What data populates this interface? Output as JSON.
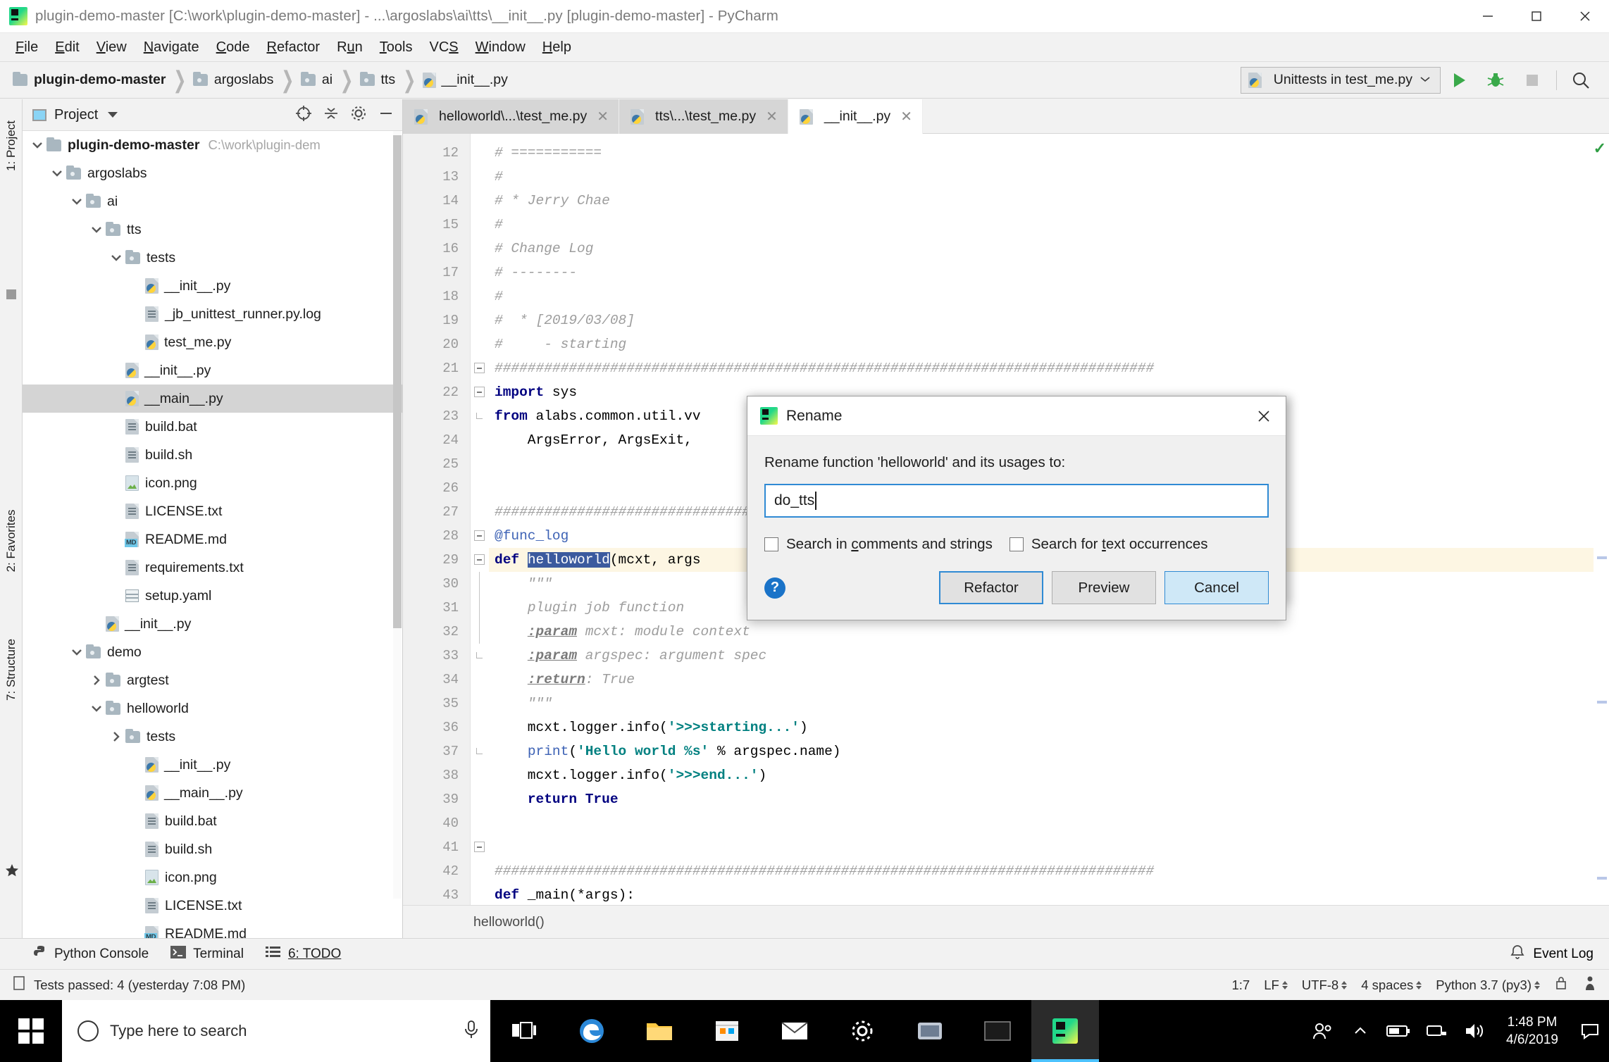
{
  "window": {
    "title": "plugin-demo-master [C:\\work\\plugin-demo-master] - ...\\argoslabs\\ai\\tts\\__init__.py [plugin-demo-master] - PyCharm",
    "minimize": "—",
    "maximize": "□",
    "close": "✕"
  },
  "menu": [
    {
      "label": "File"
    },
    {
      "label": "Edit"
    },
    {
      "label": "View"
    },
    {
      "label": "Navigate"
    },
    {
      "label": "Code"
    },
    {
      "label": "Refactor"
    },
    {
      "label": "Run"
    },
    {
      "label": "Tools"
    },
    {
      "label": "VCS"
    },
    {
      "label": "Window"
    },
    {
      "label": "Help"
    }
  ],
  "breadcrumb": [
    {
      "label": "plugin-demo-master",
      "icon": "folder-icon",
      "bold": true
    },
    {
      "label": "argoslabs",
      "icon": "folder-icon",
      "bold": false
    },
    {
      "label": "ai",
      "icon": "folder-icon",
      "bold": false
    },
    {
      "label": "tts",
      "icon": "folder-icon",
      "bold": false
    },
    {
      "label": "__init__.py",
      "icon": "python-file-icon",
      "bold": false
    }
  ],
  "toolbar": {
    "run_config": "Unittests in test_me.py",
    "run_config_icon": "python-test-icon",
    "chevron": "∨",
    "run_icon": "run-icon",
    "debug_icon": "debug-icon",
    "stop_icon": "stop-icon",
    "search_icon": "search-icon"
  },
  "rail": {
    "project": "1: Project",
    "favorites": "2: Favorites",
    "structure": "7: Structure"
  },
  "project_panel": {
    "title": "Project",
    "caret": "▾",
    "locate_icon": "locate-target-icon",
    "collapse_icon": "collapse-all-icon",
    "settings_icon": "gear-icon",
    "hide_icon": "hide-icon",
    "tree": [
      {
        "label": "plugin-demo-master",
        "path": "C:\\work\\plugin-dem",
        "indent": 0,
        "twisty": "down",
        "icon": "folder-icon",
        "bold": true,
        "selected": false
      },
      {
        "label": "argoslabs",
        "path": "",
        "indent": 1,
        "twisty": "down",
        "icon": "folder-icon",
        "bold": false,
        "selected": false
      },
      {
        "label": "ai",
        "path": "",
        "indent": 2,
        "twisty": "down",
        "icon": "folder-icon",
        "bold": false,
        "selected": false
      },
      {
        "label": "tts",
        "path": "",
        "indent": 3,
        "twisty": "down",
        "icon": "folder-icon",
        "bold": false,
        "selected": false
      },
      {
        "label": "tests",
        "path": "",
        "indent": 4,
        "twisty": "down",
        "icon": "folder-icon",
        "bold": false,
        "selected": false
      },
      {
        "label": "__init__.py",
        "path": "",
        "indent": 5,
        "twisty": "",
        "icon": "python-file-icon",
        "bold": false,
        "selected": false
      },
      {
        "label": "_jb_unittest_runner.py.log",
        "path": "",
        "indent": 5,
        "twisty": "",
        "icon": "text-file-icon",
        "bold": false,
        "selected": false
      },
      {
        "label": "test_me.py",
        "path": "",
        "indent": 5,
        "twisty": "",
        "icon": "python-file-icon",
        "bold": false,
        "selected": false
      },
      {
        "label": "__init__.py",
        "path": "",
        "indent": 4,
        "twisty": "",
        "icon": "python-file-icon",
        "bold": false,
        "selected": false
      },
      {
        "label": "__main__.py",
        "path": "",
        "indent": 4,
        "twisty": "",
        "icon": "python-file-icon",
        "bold": false,
        "selected": true
      },
      {
        "label": "build.bat",
        "path": "",
        "indent": 4,
        "twisty": "",
        "icon": "text-file-icon",
        "bold": false,
        "selected": false
      },
      {
        "label": "build.sh",
        "path": "",
        "indent": 4,
        "twisty": "",
        "icon": "text-file-icon",
        "bold": false,
        "selected": false
      },
      {
        "label": "icon.png",
        "path": "",
        "indent": 4,
        "twisty": "",
        "icon": "image-file-icon",
        "bold": false,
        "selected": false
      },
      {
        "label": "LICENSE.txt",
        "path": "",
        "indent": 4,
        "twisty": "",
        "icon": "text-file-icon",
        "bold": false,
        "selected": false
      },
      {
        "label": "README.md",
        "path": "",
        "indent": 4,
        "twisty": "",
        "icon": "markdown-file-icon",
        "bold": false,
        "selected": false
      },
      {
        "label": "requirements.txt",
        "path": "",
        "indent": 4,
        "twisty": "",
        "icon": "text-file-icon",
        "bold": false,
        "selected": false
      },
      {
        "label": "setup.yaml",
        "path": "",
        "indent": 4,
        "twisty": "",
        "icon": "yaml-file-icon",
        "bold": false,
        "selected": false
      },
      {
        "label": "__init__.py",
        "path": "",
        "indent": 3,
        "twisty": "",
        "icon": "python-file-icon",
        "bold": false,
        "selected": false
      },
      {
        "label": "demo",
        "path": "",
        "indent": 2,
        "twisty": "down",
        "icon": "folder-icon",
        "bold": false,
        "selected": false
      },
      {
        "label": "argtest",
        "path": "",
        "indent": 3,
        "twisty": "right",
        "icon": "folder-icon",
        "bold": false,
        "selected": false
      },
      {
        "label": "helloworld",
        "path": "",
        "indent": 3,
        "twisty": "down",
        "icon": "folder-icon",
        "bold": false,
        "selected": false
      },
      {
        "label": "tests",
        "path": "",
        "indent": 4,
        "twisty": "right",
        "icon": "folder-icon",
        "bold": false,
        "selected": false
      },
      {
        "label": "__init__.py",
        "path": "",
        "indent": 5,
        "twisty": "",
        "icon": "python-file-icon",
        "bold": false,
        "selected": false
      },
      {
        "label": "__main__.py",
        "path": "",
        "indent": 5,
        "twisty": "",
        "icon": "python-file-icon",
        "bold": false,
        "selected": false
      },
      {
        "label": "build.bat",
        "path": "",
        "indent": 5,
        "twisty": "",
        "icon": "text-file-icon",
        "bold": false,
        "selected": false
      },
      {
        "label": "build.sh",
        "path": "",
        "indent": 5,
        "twisty": "",
        "icon": "text-file-icon",
        "bold": false,
        "selected": false
      },
      {
        "label": "icon.png",
        "path": "",
        "indent": 5,
        "twisty": "",
        "icon": "image-file-icon",
        "bold": false,
        "selected": false
      },
      {
        "label": "LICENSE.txt",
        "path": "",
        "indent": 5,
        "twisty": "",
        "icon": "text-file-icon",
        "bold": false,
        "selected": false
      },
      {
        "label": "README.md",
        "path": "",
        "indent": 5,
        "twisty": "",
        "icon": "markdown-file-icon",
        "bold": false,
        "selected": false
      }
    ]
  },
  "editor": {
    "tabs": [
      {
        "label": "helloworld\\...\\test_me.py",
        "icon": "python-file-icon",
        "active": false,
        "close": "✕"
      },
      {
        "label": "tts\\...\\test_me.py",
        "icon": "python-file-icon",
        "active": false,
        "close": "✕"
      },
      {
        "label": "__init__.py",
        "icon": "python-file-icon",
        "active": true,
        "close": "✕"
      }
    ],
    "first_line_number": 12,
    "lines": [
      {
        "n": 12,
        "text": "# ==========="
      },
      {
        "n": 13,
        "text": "#"
      },
      {
        "n": 14,
        "text": "# * Jerry Chae"
      },
      {
        "n": 15,
        "text": "#"
      },
      {
        "n": 16,
        "text": "# Change Log"
      },
      {
        "n": 17,
        "text": "# --------"
      },
      {
        "n": 18,
        "text": "#"
      },
      {
        "n": 19,
        "text": "#  * [2019/03/08]"
      },
      {
        "n": 20,
        "text": "#     - starting"
      },
      {
        "n": 21,
        "text": "################################################################################"
      },
      {
        "n": 22,
        "text": "import sys"
      },
      {
        "n": 23,
        "text": "from alabs.common.util.vv"
      },
      {
        "n": 24,
        "text": "    ArgsError, ArgsExit,"
      },
      {
        "n": 25,
        "text": ""
      },
      {
        "n": 26,
        "text": ""
      },
      {
        "n": 27,
        "text": "################################"
      },
      {
        "n": 28,
        "text": "@func_log"
      },
      {
        "n": 29,
        "text": "def helloworld(mcxt, args"
      },
      {
        "n": 30,
        "text": "    \"\"\""
      },
      {
        "n": 31,
        "text": "    plugin job function"
      },
      {
        "n": 32,
        "text": "    :param mcxt: module context"
      },
      {
        "n": 33,
        "text": "    :param argspec: argument spec"
      },
      {
        "n": 34,
        "text": "    :return: True"
      },
      {
        "n": 35,
        "text": "    \"\"\""
      },
      {
        "n": 36,
        "text": "    mcxt.logger.info('>>>starting...')"
      },
      {
        "n": 37,
        "text": "    print('Hello world %s' % argspec.name)"
      },
      {
        "n": 38,
        "text": "    mcxt.logger.info('>>>end...')"
      },
      {
        "n": 39,
        "text": "    return True"
      },
      {
        "n": 40,
        "text": ""
      },
      {
        "n": 41,
        "text": ""
      },
      {
        "n": 42,
        "text": "################################################################################"
      },
      {
        "n": 43,
        "text": "def _main(*args):"
      }
    ],
    "highlighted_line": 29,
    "selected_token": "helloworld",
    "footer_text": "helloworld()",
    "inspection_status": "✓"
  },
  "dialog": {
    "title": "Rename",
    "icon": "pycharm-icon",
    "close": "✕",
    "prompt": "Rename function 'helloworld' and its usages to:",
    "input_value": "do_tts",
    "checkboxes": [
      {
        "label_pre": "Search in ",
        "label_key": "c",
        "label_post": "omments and strings",
        "checked": false
      },
      {
        "label_pre": "Search for ",
        "label_key": "t",
        "label_post": "ext occurrences",
        "checked": false
      }
    ],
    "help": "?",
    "buttons": [
      {
        "label": "Refactor",
        "style": "default"
      },
      {
        "label": "Preview",
        "style": "normal"
      },
      {
        "label": "Cancel",
        "style": "lightblue"
      }
    ]
  },
  "bottom_tools": [
    {
      "label": "Python Console",
      "icon": "python-icon"
    },
    {
      "label": "Terminal",
      "icon": "terminal-icon"
    },
    {
      "label": "6: TODO",
      "icon": "todo-icon"
    }
  ],
  "bottom_right": {
    "event_log": "Event Log",
    "event_log_icon": "bell-icon"
  },
  "statusbar": {
    "message": "Tests passed: 4 (yesterday 7:08 PM)",
    "message_icon": "test-status-icon",
    "caret_position": "1:7",
    "line_separator": "LF",
    "encoding": "UTF-8",
    "indent": "4 spaces",
    "interpreter": "Python 3.7 (py3)",
    "lock_icon": "lock-icon",
    "inspector_icon": "inspector-icon"
  },
  "taskbar": {
    "start_icon": "windows-start-icon",
    "search_placeholder": "Type here to search",
    "mic_icon": "microphone-icon",
    "items": [
      {
        "icon": "task-view-icon",
        "name": "task-view",
        "active": false
      },
      {
        "icon": "edge-icon",
        "name": "microsoft-edge",
        "active": false
      },
      {
        "icon": "file-explorer-icon",
        "name": "file-explorer",
        "active": false
      },
      {
        "icon": "store-icon",
        "name": "microsoft-store",
        "active": false
      },
      {
        "icon": "mail-icon",
        "name": "mail",
        "active": false
      },
      {
        "icon": "settings-icon",
        "name": "settings",
        "active": false
      },
      {
        "icon": "app-icon",
        "name": "unknown-app",
        "active": false
      },
      {
        "icon": "console-icon",
        "name": "console",
        "active": false
      },
      {
        "icon": "pycharm-icon",
        "name": "pycharm",
        "active": true
      }
    ],
    "tray": {
      "people_icon": "people-icon",
      "chevron_up": "∧",
      "battery_icon": "battery-icon",
      "network_icon": "network-icon",
      "volume_icon": "volume-icon",
      "time": "1:48 PM",
      "date": "4/6/2019",
      "action_center_icon": "action-center-icon"
    }
  }
}
